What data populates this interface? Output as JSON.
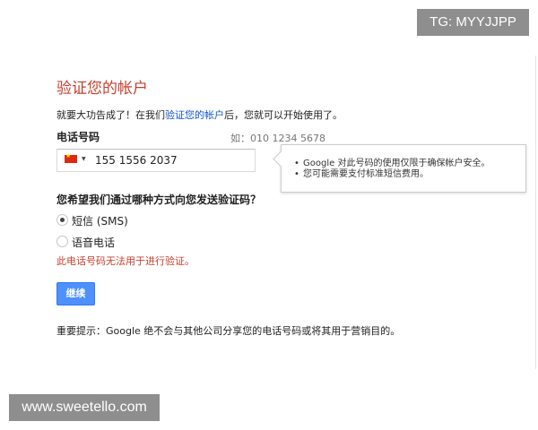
{
  "watermarks": {
    "top": "TG: MYYJJPP",
    "bottom": "www.sweetello.com"
  },
  "page": {
    "title": "验证您的帐户",
    "intro_before": "就要大功告成了！在我们",
    "intro_link": "验证您的帐户",
    "intro_after": "后，您就可以开始使用了。"
  },
  "phone": {
    "label": "电话号码",
    "example": "如：010 1234 5678",
    "country_icon": "china-flag-icon",
    "value": "155 1556 2037"
  },
  "tooltip": {
    "items": [
      "Google 对此号码的使用仅限于确保帐户安全。",
      "您可能需要支付标准短信费用。"
    ]
  },
  "method": {
    "question": "您希望我们通过哪种方式向您发送验证码？",
    "options": [
      {
        "label": "短信 (SMS)",
        "selected": true
      },
      {
        "label": "语音电话",
        "selected": false
      }
    ]
  },
  "error": "此电话号码无法用于进行验证。",
  "continue_label": "继续",
  "notice": "重要提示：Google 绝不会与其他公司分享您的电话号码或将其用于营销目的。",
  "colors": {
    "title": "#c5402f",
    "error": "#c5402f",
    "button": "#4d90fe",
    "link": "#1155cc"
  }
}
